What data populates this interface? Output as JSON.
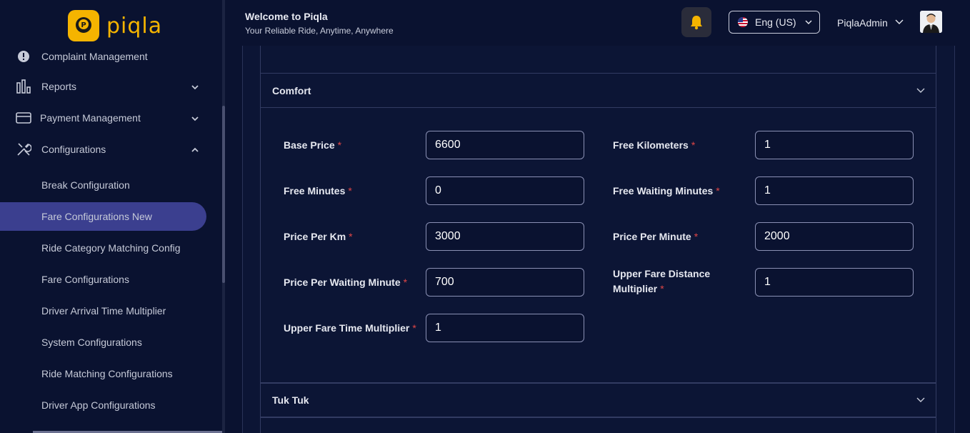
{
  "app": {
    "logo_text": "piqla",
    "brand_color": "#f5b400"
  },
  "header": {
    "title": "Welcome to Piqla",
    "subtitle": "Your Reliable Ride, Anytime, Anywhere",
    "language": "Eng (US)",
    "user_name": "PiqlaAdmin",
    "bell_icon": "bell-icon"
  },
  "sidebar": {
    "items": [
      {
        "label": "Complaint Management",
        "icon": "alert-circle-icon"
      },
      {
        "label": "Reports",
        "icon": "bar-chart-icon"
      },
      {
        "label": "Payment Management",
        "icon": "credit-card-icon"
      },
      {
        "label": "Configurations",
        "icon": "tools-icon"
      }
    ],
    "sub_items": [
      {
        "label": "Break Configuration"
      },
      {
        "label": "Fare Configurations New",
        "active": true
      },
      {
        "label": "Ride Category Matching Config"
      },
      {
        "label": "Fare Configurations"
      },
      {
        "label": "Driver Arrival Time Multiplier"
      },
      {
        "label": "System Configurations"
      },
      {
        "label": "Ride Matching Configurations"
      },
      {
        "label": "Driver App Configurations"
      }
    ]
  },
  "sections": [
    {
      "title": "Comfort",
      "fields": [
        {
          "label": "Base Price",
          "value": "6600"
        },
        {
          "label": "Free Kilometers",
          "value": "1"
        },
        {
          "label": "Free Minutes",
          "value": "0"
        },
        {
          "label": "Free Waiting Minutes",
          "value": "1"
        },
        {
          "label": "Price Per Km",
          "value": "3000"
        },
        {
          "label": "Price Per Minute",
          "value": "2000"
        },
        {
          "label": "Price Per Waiting Minute",
          "value": "700"
        },
        {
          "label_line1": "Upper Fare Distance",
          "label_line2": "Multiplier",
          "value": "1"
        },
        {
          "label": "Upper Fare Time Multiplier",
          "value": "1"
        }
      ]
    },
    {
      "title": "Tuk Tuk"
    }
  ],
  "required_mark": "*"
}
